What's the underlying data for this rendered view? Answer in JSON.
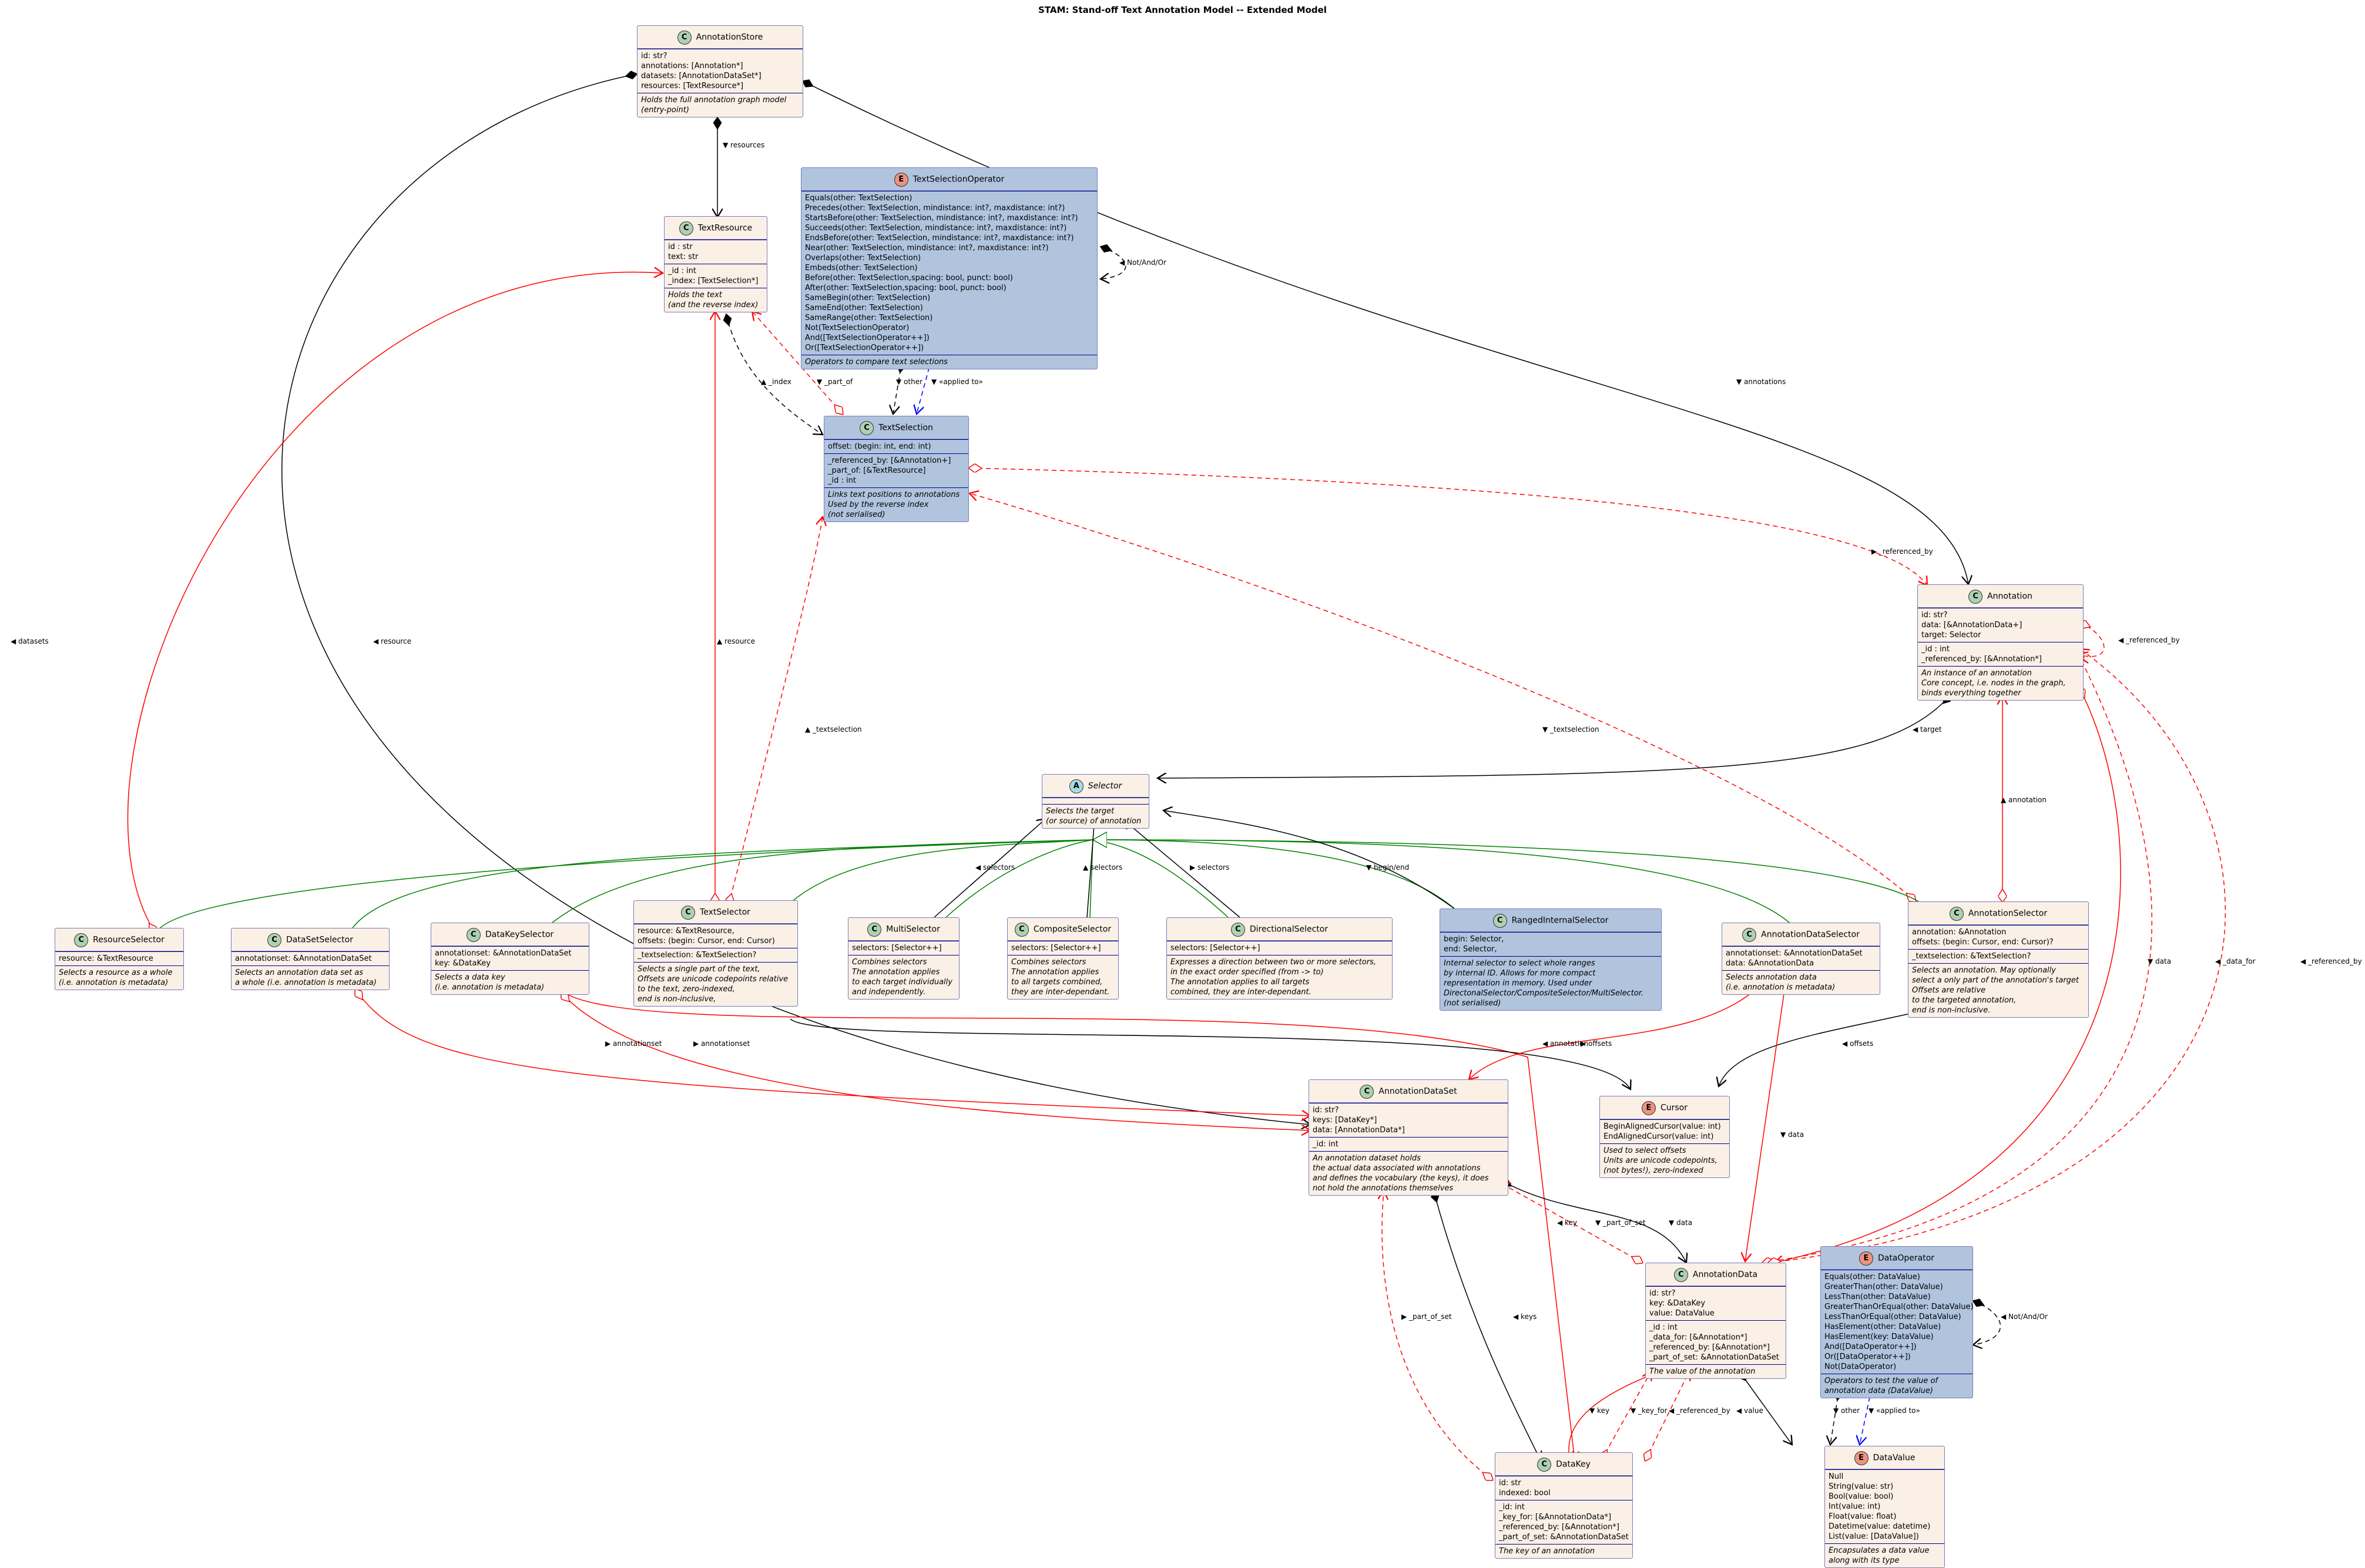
{
  "title": "STAM: Stand-off Text Annotation Model -- Extended Model",
  "colors": {
    "class_fill": "#faf0e6",
    "highlight_fill": "#b0c4de",
    "class_badge": "#add1b2",
    "enum_badge": "#eb937f",
    "abstract_badge": "#a9dcdf",
    "edge_black": "#000000",
    "edge_red": "#ff0000",
    "edge_green": "#008000",
    "edge_blue": "#0000ff"
  },
  "classes": {
    "annotation_store": {
      "kind": "C",
      "name": "AnnotationStore",
      "attrs": [
        "id: str?",
        "annotations: [Annotation*]",
        "datasets: [AnnotationDataSet*]",
        "resources: [TextResource*]"
      ],
      "note": [
        "Holds the full annotation graph model",
        "(entry-point)"
      ]
    },
    "text_selection_operator": {
      "kind": "E",
      "name": "TextSelectionOperator",
      "attrs": [
        "Equals(other: TextSelection)",
        "Precedes(other: TextSelection, mindistance: int?, maxdistance: int?)",
        "StartsBefore(other: TextSelection, mindistance: int?, maxdistance: int?)",
        "Succeeds(other: TextSelection, mindistance: int?, maxdistance: int?)",
        "EndsBefore(other: TextSelection, mindistance: int?, maxdistance: int?)",
        "Near(other: TextSelection, mindistance: int?, maxdistance: int?)",
        "Overlaps(other: TextSelection)",
        "Embeds(other: TextSelection)",
        "Before(other: TextSelection,spacing: bool, punct: bool)",
        "After(other: TextSelection,spacing: bool, punct: bool)",
        "SameBegin(other: TextSelection)",
        "SameEnd(other: TextSelection)",
        "SameRange(other: TextSelection)",
        "Not(TextSelectionOperator)",
        "And([TextSelectionOperator++])",
        "Or([TextSelectionOperator++])"
      ],
      "note": [
        "Operators to compare text selections"
      ]
    },
    "text_resource": {
      "kind": "C",
      "name": "TextResource",
      "attrs": [
        "id : str",
        "text: str"
      ],
      "private": [
        "_id : int",
        "_index: [TextSelection*]"
      ],
      "note": [
        "Holds the text",
        "(and the reverse index)"
      ]
    },
    "text_selection": {
      "kind": "C",
      "name": "TextSelection",
      "attrs": [
        "offset: (begin: int, end: int)"
      ],
      "private": [
        "_referenced_by: [&Annotation+]",
        "_part_of: [&TextResource]",
        "_id : int"
      ],
      "note": [
        "Links text positions to annotations",
        "Used by the reverse index",
        "(not serialised)"
      ]
    },
    "annotation": {
      "kind": "C",
      "name": "Annotation",
      "attrs": [
        "id: str?",
        "data: [&AnnotationData+]",
        "target: Selector"
      ],
      "private": [
        "_id : int",
        "_referenced_by: [&Annotation*]"
      ],
      "note": [
        "An instance of an annotation",
        "Core concept, i.e. nodes in the graph,",
        "binds everything together"
      ]
    },
    "selector": {
      "kind": "A",
      "name": "Selector",
      "note": [
        "Selects the target",
        "(or source) of annotation"
      ]
    },
    "resource_selector": {
      "kind": "C",
      "name": "ResourceSelector",
      "attrs": [
        "resource: &TextResource"
      ],
      "note": [
        "Selects a resource as a whole",
        "(i.e. annotation is metadata)"
      ]
    },
    "dataset_selector": {
      "kind": "C",
      "name": "DataSetSelector",
      "attrs": [
        "annotationset: &AnnotationDataSet"
      ],
      "note": [
        "Selects an annotation data set as",
        "a whole (i.e. annotation is metadata)"
      ]
    },
    "datakey_selector": {
      "kind": "C",
      "name": "DataKeySelector",
      "attrs": [
        "annotationset: &AnnotationDataSet",
        "key: &DataKey"
      ],
      "note": [
        "Selects a data key",
        "(i.e. annotation is metadata)"
      ]
    },
    "text_selector": {
      "kind": "C",
      "name": "TextSelector",
      "attrs": [
        "resource: &TextResource,",
        "offsets: (begin: Cursor, end: Cursor)"
      ],
      "private": [
        "_textselection: &TextSelection?"
      ],
      "note": [
        "Selects a single part of the text,",
        "Offsets are unicode codepoints relative",
        "to the text, zero-indexed,",
        "end is non-inclusive,"
      ]
    },
    "multi_selector": {
      "kind": "C",
      "name": "MultiSelector",
      "attrs": [
        "selectors: [Selector++]"
      ],
      "note": [
        "Combines selectors",
        "The annotation applies",
        "to each target individually",
        "and independently."
      ]
    },
    "composite_selector": {
      "kind": "C",
      "name": "CompositeSelector",
      "attrs": [
        "selectors: [Selector++]"
      ],
      "note": [
        "Combines selectors",
        "The annotation applies",
        "to all targets combined,",
        "they are inter-dependant."
      ]
    },
    "directional_selector": {
      "kind": "C",
      "name": "DirectionalSelector",
      "attrs": [
        "selectors: [Selector++]"
      ],
      "note": [
        "Expresses a direction between two or more selectors,",
        "in the exact order specified (from -> to)",
        "The annotation applies to all targets",
        "combined, they are inter-dependant."
      ]
    },
    "ranged_internal_selector": {
      "kind": "C",
      "name": "RangedInternalSelector",
      "attrs": [
        "begin: Selector,",
        "end: Selector,"
      ],
      "note": [
        "Internal selector to select whole ranges",
        "by internal ID. Allows for more compact",
        "representation in memory. Used under",
        "DirectonalSelector/CompositeSelector/MultiSelector.",
        "(not serialised)"
      ]
    },
    "annotation_data_selector": {
      "kind": "C",
      "name": "AnnotationDataSelector",
      "attrs": [
        "annotationset: &AnnotationDataSet",
        "data: &AnnotationData"
      ],
      "note": [
        "Selects annotation data",
        "(i.e. annotation is metadata)"
      ]
    },
    "annotation_selector": {
      "kind": "C",
      "name": "AnnotationSelector",
      "attrs": [
        "annotation: &Annotation",
        "offsets: (begin: Cursor, end: Cursor)?"
      ],
      "private": [
        "_textselection: &TextSelection?"
      ],
      "note": [
        "Selects an annotation. May optionally",
        "select a only part of the annotation's target",
        "Offsets are relative",
        "to the targeted annotation,",
        "end is non-inclusive."
      ]
    },
    "annotation_dataset": {
      "kind": "C",
      "name": "AnnotationDataSet",
      "attrs": [
        "id: str?",
        "keys: [DataKey*]",
        "data: [AnnotationData*]"
      ],
      "private": [
        "_id: int"
      ],
      "note": [
        "An annotation dataset holds",
        "the actual data associated with annotations",
        "and defines the vocabulary (the keys), it does",
        "not hold the annotations themselves"
      ]
    },
    "cursor": {
      "kind": "E",
      "name": "Cursor",
      "attrs": [
        "BeginAlignedCursor(value: int)",
        "EndAlignedCursor(value: int)"
      ],
      "note": [
        "Used to select offsets",
        "Units are unicode codepoints,",
        "(not bytes!), zero-indexed"
      ]
    },
    "annotation_data": {
      "kind": "C",
      "name": "AnnotationData",
      "attrs": [
        "id: str?",
        "key: &DataKey",
        "value: DataValue"
      ],
      "private": [
        "_id : int",
        "_data_for: [&Annotation*]",
        "_referenced_by: [&Annotation*]",
        "_part_of_set: &AnnotationDataSet"
      ],
      "note": [
        "The value of the annotation"
      ]
    },
    "data_operator": {
      "kind": "E",
      "name": "DataOperator",
      "attrs": [
        "Equals(other: DataValue)",
        "GreaterThan(other: DataValue)",
        "LessThan(other: DataValue)",
        "GreaterThanOrEqual(other: DataValue)",
        "LessThanOrEqual(other: DataValue)",
        "HasElement(other: DataValue)",
        "HasElement(key: DataValue)",
        "And([DataOperator++])",
        "Or([DataOperator++])",
        "Not(DataOperator)"
      ],
      "note": [
        "Operators to test the value of",
        "annotation data (DataValue)"
      ]
    },
    "data_key": {
      "kind": "C",
      "name": "DataKey",
      "attrs": [
        "id: str",
        "indexed: bool"
      ],
      "private": [
        "_id: int",
        "_key_for: [&AnnotationData*]",
        "_referenced_by: [&Annotation*]",
        "_part_of_set: &AnnotationDataSet"
      ],
      "note": [
        "The key of an annotation"
      ]
    },
    "data_value": {
      "kind": "E",
      "name": "DataValue",
      "attrs": [
        "Null",
        "String(value: str)",
        "Bool(value: bool)",
        "Int(value: int)",
        "Float(value: float)",
        "Datetime(value: datetime)",
        "List(value: [DataValue])"
      ],
      "note": [
        "Encapsulates a data value",
        "along with its type"
      ]
    }
  },
  "edge_labels": {
    "resources": "▼ resources",
    "datasets": "◀ datasets",
    "annotations": "▼ annotations",
    "not_and_or_ts": "◀ Not/And/Or",
    "index": "▲ _index",
    "part_of": "▼ _part_of",
    "other_ts": "▼ other",
    "applied_ts": "▼ «applied to»",
    "resource_rs": "◀ resource",
    "resource_ts": "▲ resource",
    "textselection_1": "▲ _textselection",
    "textselection_2": "▼ _textselection",
    "referenced_by_ts": "▶ _referenced_by",
    "referenced_by_self": "◀ _referenced_by",
    "target": "◀ target",
    "annotation": "▲ annotation",
    "data_ann": "▼ data",
    "data_for": "◀ _data_for",
    "referenced_by_ad": "◀ _referenced_by",
    "selectors_multi": "◀ selectors",
    "selectors_comp": "▲ selectors",
    "selectors_dir": "▶ selectors",
    "begin_end": "▼ begin/end",
    "annotationset_1": "▶ annotationset",
    "annotationset_2": "▶ annotationset",
    "annotation_ads": "◀ annotation",
    "offsets_ts": "▶ offsets",
    "offsets_as": "◀ offsets",
    "data_ads": "▼ data",
    "part_of_set_ad": "▼ _part_of_set",
    "data_set": "▼ data",
    "key_ads": "◀ key",
    "part_of_set_dk": "▶ _part_of_set",
    "keys": "◀ keys",
    "key": "▼ key",
    "key_for": "▼ _key_for",
    "referenced_by_dk": "◀ _referenced_by",
    "value": "◀ value",
    "not_and_or_do": "◀ Not/And/Or",
    "other_do": "▼ other",
    "applied_do": "▼ «applied to»"
  }
}
